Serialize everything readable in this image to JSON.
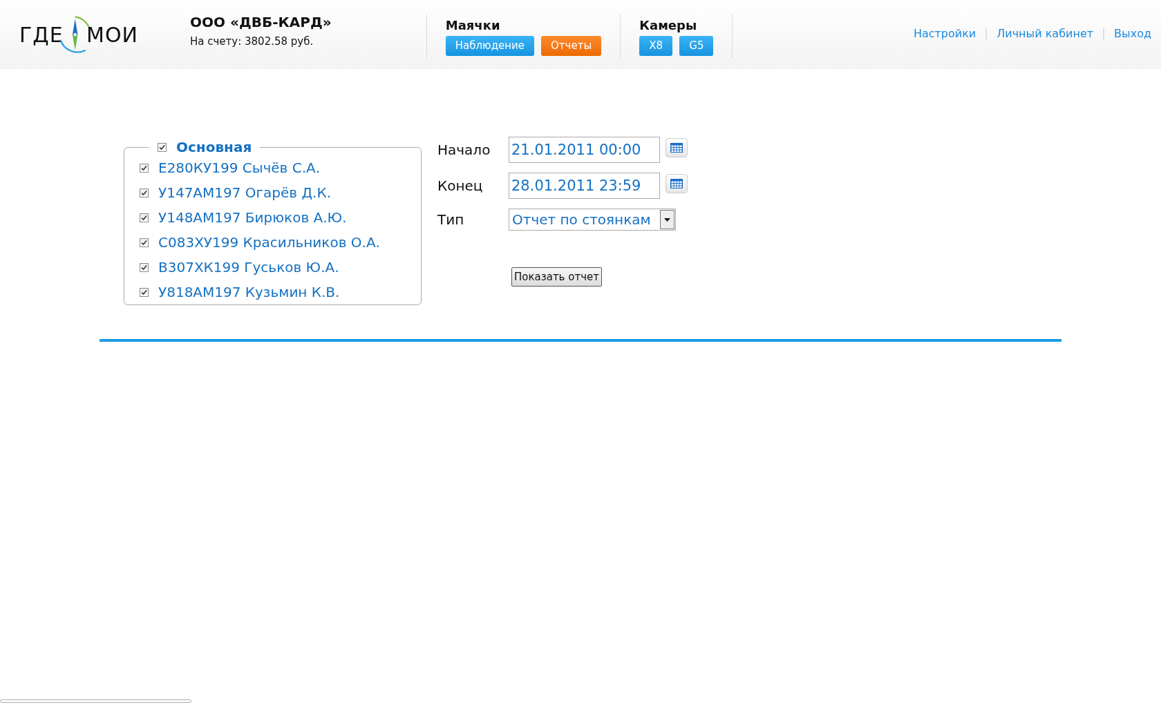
{
  "logo": {
    "left": "ГДЕ",
    "right": "МОИ"
  },
  "account": {
    "company": "ООО «ДВБ-КАРД»",
    "balance": "На счету: 3802.58 руб."
  },
  "nav_groups": [
    {
      "title": "Маячки",
      "buttons": [
        {
          "label": "Наблюдение",
          "selected": false
        },
        {
          "label": "Отчеты",
          "selected": true
        }
      ]
    },
    {
      "title": "Камеры",
      "buttons": [
        {
          "label": "X8",
          "selected": false
        },
        {
          "label": "G5",
          "selected": false
        }
      ]
    }
  ],
  "top_links": [
    "Настройки",
    "Личный кабинет",
    "Выход"
  ],
  "group": {
    "title": "Основная",
    "checked": true,
    "items": [
      {
        "label": "Е280КУ199 Сычёв С.А.",
        "checked": true
      },
      {
        "label": "У147АМ197 Огарёв Д.К.",
        "checked": true
      },
      {
        "label": "У148АМ197 Бирюков А.Ю.",
        "checked": true
      },
      {
        "label": "С083ХУ199 Красильников О.А.",
        "checked": true
      },
      {
        "label": "В307ХК199 Гуськов Ю.А.",
        "checked": true
      },
      {
        "label": "У818АМ197 Кузьмин К.В.",
        "checked": true
      }
    ]
  },
  "form": {
    "start": {
      "label": "Начало",
      "value": "21.01.2011 00:00"
    },
    "end": {
      "label": "Конец",
      "value": "28.01.2011 23:59"
    },
    "type": {
      "label": "Тип",
      "value": "Отчет по стоянкам"
    },
    "submit": "Показать отчет"
  }
}
